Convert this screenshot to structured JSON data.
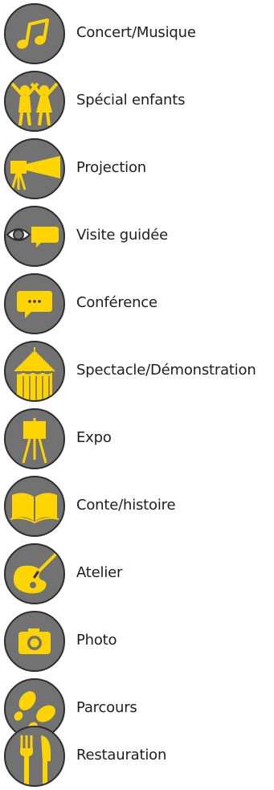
{
  "colors": {
    "icon_fill": "#727272",
    "icon_border": "#2e2e2e",
    "accent_yellow": "#ffd400",
    "text": "#1e1e1e"
  },
  "legend": {
    "items": [
      {
        "label": "Concert/Musique",
        "icon": "music-note-icon"
      },
      {
        "label": "Spécial enfants",
        "icon": "children-icon"
      },
      {
        "label": "Projection",
        "icon": "projector-icon"
      },
      {
        "label": "Visite guidée",
        "icon": "guided-tour-eye-icon"
      },
      {
        "label": "Conférence",
        "icon": "speech-bubble-icon"
      },
      {
        "label": "Spectacle/Démonstration",
        "icon": "circus-tent-icon"
      },
      {
        "label": "Expo",
        "icon": "easel-icon"
      },
      {
        "label": "Conte/histoire",
        "icon": "open-book-icon"
      },
      {
        "label": "Atelier",
        "icon": "paint-palette-icon"
      },
      {
        "label": "Photo",
        "icon": "camera-icon"
      },
      {
        "label": "Parcours",
        "icon": "footprints-icon"
      },
      {
        "label": "Restauration",
        "icon": "fork-knife-icon"
      }
    ]
  }
}
